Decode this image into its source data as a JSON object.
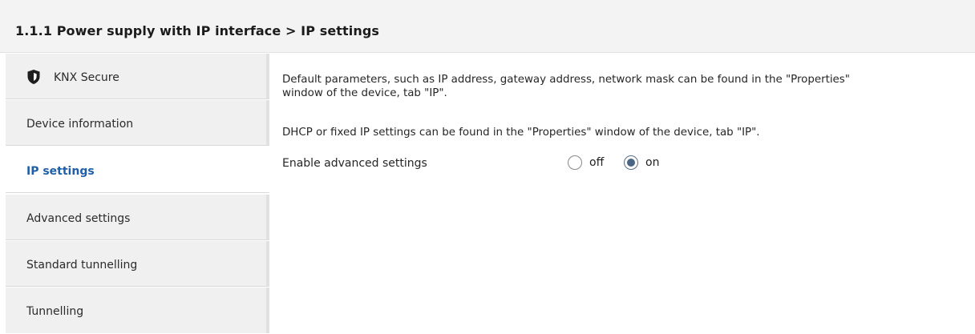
{
  "header": {
    "title": "1.1.1 Power supply with IP interface > IP settings"
  },
  "sidebar": {
    "items": [
      {
        "label": "KNX Secure",
        "icon": "shield-icon",
        "active": false
      },
      {
        "label": "Device information",
        "active": false
      },
      {
        "label": "IP settings",
        "active": true
      },
      {
        "label": "Advanced settings",
        "active": false
      },
      {
        "label": "Standard tunnelling",
        "active": false
      },
      {
        "label": "Tunnelling",
        "active": false
      }
    ]
  },
  "main": {
    "description_1": "Default parameters, such as IP address, gateway address, network mask can be found in the \"Properties\" window of the device, tab \"IP\".",
    "description_2": "DHCP or fixed IP settings can be found in the \"Properties\" window of the device, tab \"IP\".",
    "advanced_setting": {
      "label": "Enable advanced settings",
      "options": [
        {
          "label": "off",
          "selected": false
        },
        {
          "label": "on",
          "selected": true
        }
      ]
    }
  },
  "colors": {
    "active_nav_text": "#1f5fa8",
    "header_bg": "#f3f3f3",
    "sidebar_bg": "#f0f0f0",
    "radio_selected": "#4b6584"
  }
}
